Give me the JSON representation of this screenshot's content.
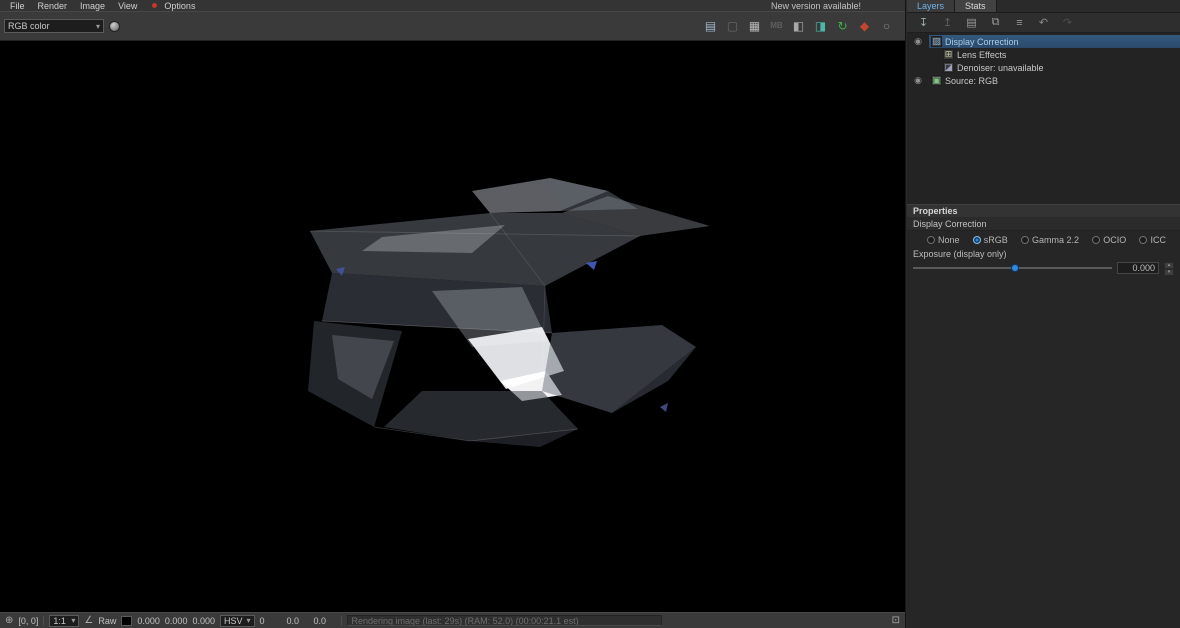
{
  "menubar": {
    "items": [
      "File",
      "Render",
      "Image",
      "View",
      "Options"
    ],
    "notice": "New version available!"
  },
  "toolbar": {
    "channel_select_value": "RGB color",
    "icons": [
      {
        "name": "save-image-icon",
        "glyph": "▤",
        "color": "#9fb6c8"
      },
      {
        "name": "clear-image-icon",
        "glyph": "▢",
        "color": "#6a6a6a"
      },
      {
        "name": "region-render-icon",
        "glyph": "▦",
        "color": "#b8b8b8"
      },
      {
        "name": "mono-channel-icon",
        "glyph": "MB",
        "color": "#5f5f5f"
      },
      {
        "name": "display-window-icon",
        "glyph": "◧",
        "color": "#a8a8a8"
      },
      {
        "name": "track-mouse-icon",
        "glyph": "◨",
        "color": "#49b8a8"
      },
      {
        "name": "render-last-icon",
        "glyph": "↻",
        "color": "#3fae4a"
      },
      {
        "name": "render-icon",
        "glyph": "◆",
        "color": "#c4452f"
      },
      {
        "name": "region-lasso-icon",
        "glyph": "○",
        "color": "#8a8a8a"
      }
    ]
  },
  "glyphs": {
    "dropdown_arrow": "▾",
    "eye": "◉",
    "spinner_up": "▴",
    "spinner_down": "▾",
    "probe": "⊕",
    "angle": "∠",
    "corner": "⊡"
  },
  "layers_panel": {
    "tabs": [
      {
        "label": "Layers"
      },
      {
        "label": "Stats"
      }
    ],
    "toolbar_icons": [
      {
        "name": "load-layers-icon",
        "glyph": "↧",
        "color": "#9ab0a0"
      },
      {
        "name": "save-layers-icon",
        "glyph": "↥",
        "color": "#5f5f5f"
      },
      {
        "name": "save-preset-icon",
        "glyph": "▤",
        "color": "#9a9a9a"
      },
      {
        "name": "copy-layers-icon",
        "glyph": "⧉",
        "color": "#9a9a9a"
      },
      {
        "name": "layer-list-icon",
        "glyph": "≡",
        "color": "#9a9a9a"
      },
      {
        "name": "undo-icon",
        "glyph": "↶",
        "color": "#8a8a8a"
      },
      {
        "name": "redo-icon",
        "glyph": "↷",
        "color": "#4f4f4f"
      }
    ],
    "rows": [
      {
        "label": "Display Correction",
        "icon_glyph": "▨",
        "icon_color": "#7fa8c8"
      },
      {
        "label": "Lens Effects",
        "icon_glyph": "⊞",
        "icon_color": "#c8c8a0"
      },
      {
        "label": "Denoiser: unavailable",
        "icon_glyph": "◪",
        "icon_color": "#a0a0c0"
      },
      {
        "label": "Source: RGB",
        "icon_glyph": "▣",
        "icon_color": "#7fc87f"
      }
    ]
  },
  "properties": {
    "header": "Properties",
    "section_title": "Display Correction",
    "options": [
      {
        "label": "None"
      },
      {
        "label": "sRGB"
      },
      {
        "label": "Gamma 2.2"
      },
      {
        "label": "OCIO"
      },
      {
        "label": "ICC"
      }
    ],
    "selected_option": "sRGB",
    "exposure_label": "Exposure (display only)",
    "exposure_value": "0.000",
    "accent_color": "#2f87e0"
  },
  "statusbar": {
    "probe_coords": "[0, 0]",
    "zoom_value": "1:1",
    "raw_label": "Raw",
    "rgb_values": [
      "0.000",
      "0.000",
      "0.000"
    ],
    "mode_value": "HSV",
    "mode_values": [
      "0",
      "0.0",
      "0.0"
    ],
    "message": "Rendering image (last: 29s) (RAM: 52.0) (00:00:21.1 est)"
  }
}
